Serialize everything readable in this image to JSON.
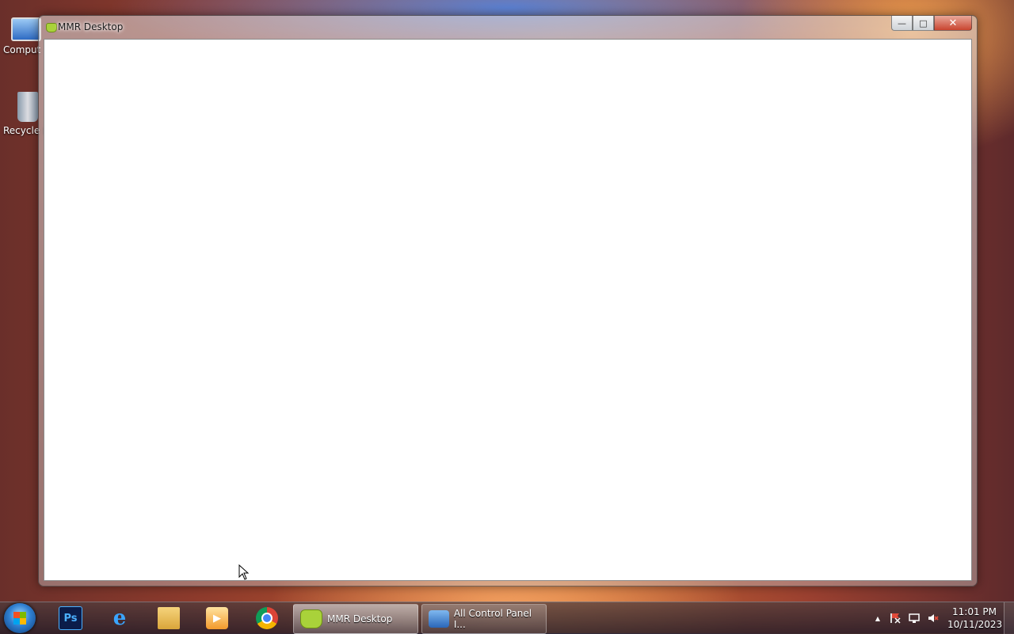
{
  "desktop": {
    "icons": [
      {
        "label": "Comput",
        "icon": "computer-icon"
      },
      {
        "label": "Recycle B",
        "icon": "recycle-bin-icon"
      }
    ]
  },
  "window": {
    "title": "MMR Desktop",
    "icon": "mmr-app-icon",
    "buttons": {
      "minimize": "minimize-icon",
      "maximize": "maximize-icon",
      "close": "close-icon"
    }
  },
  "taskbar": {
    "pinned": [
      {
        "name": "Photoshop",
        "glyph": "Ps"
      },
      {
        "name": "Internet Explorer",
        "glyph": "e"
      },
      {
        "name": "Windows Explorer",
        "glyph": ""
      },
      {
        "name": "Windows Media Player",
        "glyph": "▶"
      },
      {
        "name": "Google Chrome",
        "glyph": ""
      }
    ],
    "tasks": [
      {
        "label": "MMR Desktop",
        "state": "active"
      },
      {
        "label": "All Control Panel I...",
        "state": "inactive"
      }
    ],
    "tray": {
      "overflow_glyph": "▲",
      "icons": [
        "action-center-icon",
        "network-icon",
        "volume-muted-icon"
      ]
    },
    "clock": {
      "time": "11:01 PM",
      "date": "10/11/2023"
    }
  }
}
